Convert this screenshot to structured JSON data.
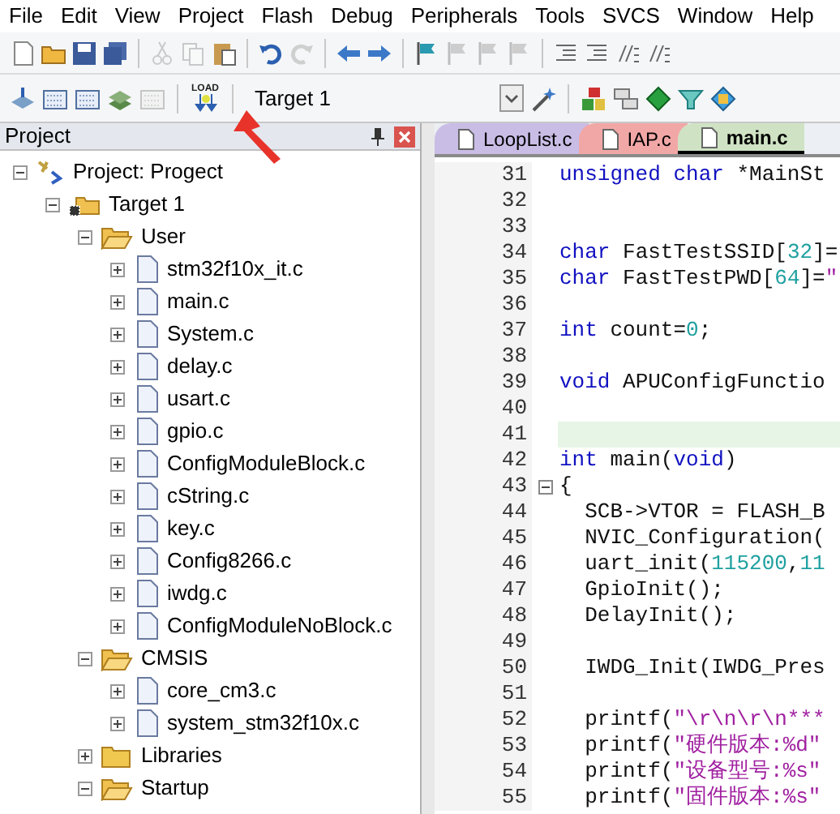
{
  "menu": [
    "File",
    "Edit",
    "View",
    "Project",
    "Flash",
    "Debug",
    "Peripherals",
    "Tools",
    "SVCS",
    "Window",
    "Help"
  ],
  "toolbar_1": [
    {
      "kind": "new",
      "disabled": false
    },
    {
      "kind": "open",
      "disabled": false
    },
    {
      "kind": "save",
      "disabled": false
    },
    {
      "kind": "save-all",
      "disabled": false
    },
    {
      "kind": "separator"
    },
    {
      "kind": "cut",
      "disabled": true
    },
    {
      "kind": "copy",
      "disabled": true
    },
    {
      "kind": "paste",
      "disabled": false
    },
    {
      "kind": "separator"
    },
    {
      "kind": "undo",
      "disabled": false
    },
    {
      "kind": "redo",
      "disabled": true
    },
    {
      "kind": "separator"
    },
    {
      "kind": "back",
      "disabled": false
    },
    {
      "kind": "forward",
      "disabled": false
    },
    {
      "kind": "separator"
    },
    {
      "kind": "bookmark",
      "disabled": false
    },
    {
      "kind": "bookmark",
      "disabled": true
    },
    {
      "kind": "bookmark",
      "disabled": true
    },
    {
      "kind": "bookmark",
      "disabled": true
    },
    {
      "kind": "separator"
    },
    {
      "kind": "indent",
      "disabled": false
    },
    {
      "kind": "indent",
      "disabled": false
    },
    {
      "kind": "comment",
      "disabled": false
    },
    {
      "kind": "comment",
      "disabled": false
    }
  ],
  "toolbar_2": [
    {
      "kind": "translate",
      "disabled": false
    },
    {
      "kind": "build",
      "disabled": false
    },
    {
      "kind": "build",
      "disabled": false
    },
    {
      "kind": "batch",
      "disabled": false
    },
    {
      "kind": "build",
      "disabled": true
    },
    {
      "kind": "separator"
    },
    {
      "kind": "load",
      "disabled": false
    }
  ],
  "target_select": {
    "value": "Target 1"
  },
  "toolbar_3": [
    {
      "kind": "wand",
      "disabled": false
    },
    {
      "kind": "separator"
    },
    {
      "kind": "components",
      "disabled": false
    },
    {
      "kind": "windows",
      "disabled": false
    },
    {
      "kind": "diamond",
      "disabled": false
    },
    {
      "kind": "funnel",
      "disabled": false
    },
    {
      "kind": "pack",
      "disabled": false
    }
  ],
  "load_label": "LOAD",
  "project_panel": {
    "title": "Project",
    "tree": [
      {
        "label": "Project: Progect",
        "kind": "project",
        "expanded": true,
        "children": [
          {
            "label": "Target 1",
            "kind": "target",
            "expanded": true,
            "children": [
              {
                "label": "User",
                "kind": "group",
                "expanded": true,
                "children": [
                  {
                    "label": "stm32f10x_it.c",
                    "kind": "file",
                    "expanded": false
                  },
                  {
                    "label": "main.c",
                    "kind": "file",
                    "expanded": false
                  },
                  {
                    "label": "System.c",
                    "kind": "file",
                    "expanded": false
                  },
                  {
                    "label": "delay.c",
                    "kind": "file",
                    "expanded": false
                  },
                  {
                    "label": "usart.c",
                    "kind": "file",
                    "expanded": false
                  },
                  {
                    "label": "gpio.c",
                    "kind": "file",
                    "expanded": false
                  },
                  {
                    "label": "ConfigModuleBlock.c",
                    "kind": "file",
                    "expanded": false
                  },
                  {
                    "label": "cString.c",
                    "kind": "file",
                    "expanded": false
                  },
                  {
                    "label": "key.c",
                    "kind": "file",
                    "expanded": false
                  },
                  {
                    "label": "Config8266.c",
                    "kind": "file",
                    "expanded": false
                  },
                  {
                    "label": "iwdg.c",
                    "kind": "file",
                    "expanded": false
                  },
                  {
                    "label": "ConfigModuleNoBlock.c",
                    "kind": "file",
                    "expanded": false
                  }
                ]
              },
              {
                "label": "CMSIS",
                "kind": "group",
                "expanded": true,
                "children": [
                  {
                    "label": "core_cm3.c",
                    "kind": "file",
                    "expanded": false
                  },
                  {
                    "label": "system_stm32f10x.c",
                    "kind": "file",
                    "expanded": false
                  }
                ]
              },
              {
                "label": "Libraries",
                "kind": "group",
                "expanded": false
              },
              {
                "label": "Startup",
                "kind": "group",
                "expanded": true
              }
            ]
          }
        ]
      }
    ]
  },
  "tabs": [
    {
      "label": "LoopList.c",
      "color": "#c9bde6",
      "selected": false
    },
    {
      "label": "IAP.c",
      "color": "#f2a7a7",
      "selected": false
    },
    {
      "label": "main.c",
      "color": "#cfe3c4",
      "selected": true
    }
  ],
  "code": [
    {
      "number": "31",
      "highlighted": false,
      "fold": false,
      "tokens": [
        {
          "kind": "keyword",
          "text": "unsigned char"
        },
        {
          "kind": "plain",
          "text": " *MainSt"
        }
      ]
    },
    {
      "number": "32",
      "highlighted": false,
      "fold": false
    },
    {
      "number": "33",
      "highlighted": false,
      "fold": false
    },
    {
      "number": "34",
      "highlighted": false,
      "fold": false,
      "tokens": [
        {
          "kind": "keyword",
          "text": "char"
        },
        {
          "kind": "plain",
          "text": " FastTestSSID["
        },
        {
          "kind": "number",
          "text": "32"
        },
        {
          "kind": "plain",
          "text": "]="
        }
      ]
    },
    {
      "number": "35",
      "highlighted": false,
      "fold": false,
      "tokens": [
        {
          "kind": "keyword",
          "text": "char"
        },
        {
          "kind": "plain",
          "text": " FastTestPWD["
        },
        {
          "kind": "number",
          "text": "64"
        },
        {
          "kind": "plain",
          "text": "]="
        },
        {
          "kind": "string",
          "text": "\""
        }
      ]
    },
    {
      "number": "36",
      "highlighted": false,
      "fold": false
    },
    {
      "number": "37",
      "highlighted": false,
      "fold": false,
      "tokens": [
        {
          "kind": "keyword",
          "text": "int"
        },
        {
          "kind": "plain",
          "text": " count="
        },
        {
          "kind": "number",
          "text": "0"
        },
        {
          "kind": "plain",
          "text": ";"
        }
      ]
    },
    {
      "number": "38",
      "highlighted": false,
      "fold": false
    },
    {
      "number": "39",
      "highlighted": false,
      "fold": false,
      "tokens": [
        {
          "kind": "keyword",
          "text": "void"
        },
        {
          "kind": "plain",
          "text": " APUConfigFunctio"
        }
      ]
    },
    {
      "number": "40",
      "highlighted": false,
      "fold": false
    },
    {
      "number": "41",
      "highlighted": true,
      "fold": false
    },
    {
      "number": "42",
      "highlighted": false,
      "fold": false,
      "tokens": [
        {
          "kind": "keyword",
          "text": "int"
        },
        {
          "kind": "plain",
          "text": " main("
        },
        {
          "kind": "keyword",
          "text": "void"
        },
        {
          "kind": "plain",
          "text": ")"
        }
      ]
    },
    {
      "number": "43",
      "highlighted": false,
      "fold": true,
      "tokens": [
        {
          "kind": "plain",
          "text": "{"
        }
      ]
    },
    {
      "number": "44",
      "highlighted": false,
      "fold": false,
      "tokens": [
        {
          "kind": "plain",
          "text": "  SCB->VTOR = FLASH_B"
        }
      ]
    },
    {
      "number": "45",
      "highlighted": false,
      "fold": false,
      "tokens": [
        {
          "kind": "plain",
          "text": "  NVIC_Configuration("
        }
      ]
    },
    {
      "number": "46",
      "highlighted": false,
      "fold": false,
      "tokens": [
        {
          "kind": "plain",
          "text": "  uart_init("
        },
        {
          "kind": "number",
          "text": "115200"
        },
        {
          "kind": "plain",
          "text": ","
        },
        {
          "kind": "number",
          "text": "11"
        }
      ]
    },
    {
      "number": "47",
      "highlighted": false,
      "fold": false,
      "tokens": [
        {
          "kind": "plain",
          "text": "  GpioInit();"
        }
      ]
    },
    {
      "number": "48",
      "highlighted": false,
      "fold": false,
      "tokens": [
        {
          "kind": "plain",
          "text": "  DelayInit();"
        }
      ]
    },
    {
      "number": "49",
      "highlighted": false,
      "fold": false
    },
    {
      "number": "50",
      "highlighted": false,
      "fold": false,
      "tokens": [
        {
          "kind": "plain",
          "text": "  IWDG_Init(IWDG_Pres"
        }
      ]
    },
    {
      "number": "51",
      "highlighted": false,
      "fold": false
    },
    {
      "number": "52",
      "highlighted": false,
      "fold": false,
      "tokens": [
        {
          "kind": "plain",
          "text": "  printf("
        },
        {
          "kind": "string",
          "text": "\"\\r\\n\\r\\n***"
        }
      ]
    },
    {
      "number": "53",
      "highlighted": false,
      "fold": false,
      "tokens": [
        {
          "kind": "plain",
          "text": "  printf("
        },
        {
          "kind": "string",
          "text": "\"硬件版本:%d\""
        }
      ]
    },
    {
      "number": "54",
      "highlighted": false,
      "fold": false,
      "tokens": [
        {
          "kind": "plain",
          "text": "  printf("
        },
        {
          "kind": "string",
          "text": "\"设备型号:%s\""
        }
      ]
    },
    {
      "number": "55",
      "highlighted": false,
      "fold": false,
      "tokens": [
        {
          "kind": "plain",
          "text": "  printf("
        },
        {
          "kind": "string",
          "text": "\"固件版本:%s\""
        }
      ]
    }
  ]
}
